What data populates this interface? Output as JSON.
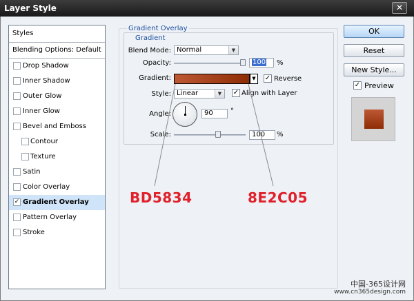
{
  "window": {
    "title": "Layer Style",
    "close_glyph": "✕"
  },
  "styles_panel": {
    "header": "Styles",
    "blending_options": "Blending Options: Default",
    "items": [
      {
        "label": "Drop Shadow",
        "checked": false,
        "sub": false,
        "selected": false
      },
      {
        "label": "Inner Shadow",
        "checked": false,
        "sub": false,
        "selected": false
      },
      {
        "label": "Outer Glow",
        "checked": false,
        "sub": false,
        "selected": false
      },
      {
        "label": "Inner Glow",
        "checked": false,
        "sub": false,
        "selected": false
      },
      {
        "label": "Bevel and Emboss",
        "checked": false,
        "sub": false,
        "selected": false
      },
      {
        "label": "Contour",
        "checked": false,
        "sub": true,
        "selected": false
      },
      {
        "label": "Texture",
        "checked": false,
        "sub": true,
        "selected": false
      },
      {
        "label": "Satin",
        "checked": false,
        "sub": false,
        "selected": false
      },
      {
        "label": "Color Overlay",
        "checked": false,
        "sub": false,
        "selected": false
      },
      {
        "label": "Gradient Overlay",
        "checked": true,
        "sub": false,
        "selected": true
      },
      {
        "label": "Pattern Overlay",
        "checked": false,
        "sub": false,
        "selected": false
      },
      {
        "label": "Stroke",
        "checked": false,
        "sub": false,
        "selected": false
      }
    ]
  },
  "gradient_overlay": {
    "group_title": "Gradient Overlay",
    "subgroup_title": "Gradient",
    "blend_mode_label": "Blend Mode:",
    "blend_mode_value": "Normal",
    "opacity_label": "Opacity:",
    "opacity_value": "100",
    "opacity_unit": "%",
    "opacity_percent": 100,
    "gradient_label": "Gradient:",
    "gradient_start_color": "#BD5834",
    "gradient_end_color": "#8E2C05",
    "reverse_label": "Reverse",
    "reverse_checked": true,
    "style_label": "Style:",
    "style_value": "Linear",
    "align_label": "Align with Layer",
    "align_checked": true,
    "angle_label": "Angle:",
    "angle_value": "90",
    "angle_unit": "°",
    "scale_label": "Scale:",
    "scale_value": "100",
    "scale_unit": "%"
  },
  "buttons": {
    "ok": "OK",
    "reset": "Reset",
    "new_style": "New Style..."
  },
  "preview": {
    "label": "Preview",
    "checked": true
  },
  "annotations": {
    "start_hex": "BD5834",
    "end_hex": "8E2C05"
  },
  "watermark": {
    "line1": "中国-365设计网",
    "line2": "www.cn365design.com"
  },
  "colors": {
    "accent_red": "#e0202a",
    "group_title_blue": "#1c4fa0",
    "selection": "#cfe4f9"
  }
}
